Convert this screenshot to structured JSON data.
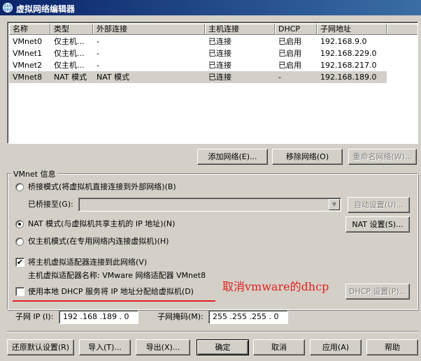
{
  "window": {
    "title": "虚拟网络编辑器",
    "icon": "vmware-network-icon"
  },
  "network_list": {
    "columns": [
      "名称",
      "类型",
      "外部连接",
      "主机连接",
      "DHCP",
      "子网地址"
    ],
    "rows": [
      {
        "name": "VMnet0",
        "type": "仅主机...",
        "external": "-",
        "host": "已连接",
        "dhcp": "已启用",
        "subnet": "192.168.9.0"
      },
      {
        "name": "VMnet1",
        "type": "仅主机...",
        "external": "-",
        "host": "已连接",
        "dhcp": "已启用",
        "subnet": "192.168.229.0"
      },
      {
        "name": "VMnet2",
        "type": "仅主机...",
        "external": "-",
        "host": "已连接",
        "dhcp": "已启用",
        "subnet": "192.168.217.0"
      },
      {
        "name": "VMnet8",
        "type": "NAT 模式",
        "external": "NAT 模式",
        "host": "已连接",
        "dhcp": "-",
        "subnet": "192.168.189.0"
      }
    ],
    "selected_index": 3
  },
  "list_buttons": {
    "add": "添加网络(E)...",
    "remove": "移除网络(O)",
    "rename": "重命名网络(W)..."
  },
  "vmnet_info": {
    "group_label": "VMnet 信息",
    "bridge_label": "桥接模式(将虚拟机直接连接到外部网络)(B)",
    "bridged_to_label": "已桥接至(G):",
    "bridged_to_value": "",
    "auto_settings": "自动设置(U)...",
    "nat_label": "NAT 模式(与虚拟机共享主机的 IP 地址)(N)",
    "nat_settings": "NAT 设置(S)...",
    "hostonly_label": "仅主机模式(在专用网络内连接虚拟机)(H)",
    "selected_mode": "nat",
    "connect_adapter_label": "将主机虚拟适配器连接到此网络(V)",
    "connect_adapter_checked": true,
    "adapter_name_text": "主机虚拟适配器名称: VMware 网络适配器 VMnet8",
    "dhcp_label": "使用本地 DHCP 服务将 IP 地址分配给虚拟机(D)",
    "dhcp_checked": false,
    "dhcp_settings": "DHCP 设置(P)...",
    "subnet_ip_label": "子网 IP (I):",
    "subnet_ip_value": "192 .168 .189 . 0",
    "subnet_mask_label": "子网掩码(M):",
    "subnet_mask_value": "255 .255 .255 . 0"
  },
  "annotation": {
    "text": "取消vmware的dhcp",
    "color": "#e02020"
  },
  "footer_buttons": {
    "restore": "还原默认设置(R)",
    "import": "导入(T)...",
    "export": "导出(X)...",
    "ok": "确定",
    "cancel": "取消",
    "apply": "应用(A)",
    "help": "帮助"
  },
  "colors": {
    "titlebar_start": "#0a246a",
    "titlebar_end": "#3a6ea5",
    "dialog_bg": "#d4d0c8"
  }
}
